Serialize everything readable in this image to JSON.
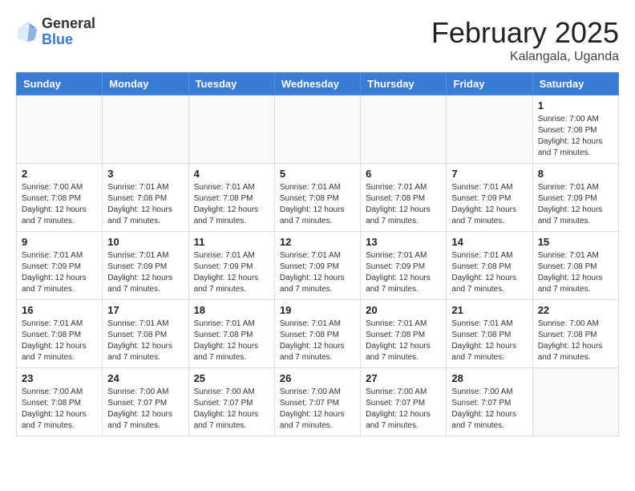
{
  "logo": {
    "general": "General",
    "blue": "Blue"
  },
  "header": {
    "month": "February 2025",
    "location": "Kalangala, Uganda"
  },
  "weekdays": [
    "Sunday",
    "Monday",
    "Tuesday",
    "Wednesday",
    "Thursday",
    "Friday",
    "Saturday"
  ],
  "weeks": [
    [
      {
        "day": "",
        "info": ""
      },
      {
        "day": "",
        "info": ""
      },
      {
        "day": "",
        "info": ""
      },
      {
        "day": "",
        "info": ""
      },
      {
        "day": "",
        "info": ""
      },
      {
        "day": "",
        "info": ""
      },
      {
        "day": "1",
        "info": "Sunrise: 7:00 AM\nSunset: 7:08 PM\nDaylight: 12 hours\nand 7 minutes."
      }
    ],
    [
      {
        "day": "2",
        "info": "Sunrise: 7:00 AM\nSunset: 7:08 PM\nDaylight: 12 hours\nand 7 minutes."
      },
      {
        "day": "3",
        "info": "Sunrise: 7:01 AM\nSunset: 7:08 PM\nDaylight: 12 hours\nand 7 minutes."
      },
      {
        "day": "4",
        "info": "Sunrise: 7:01 AM\nSunset: 7:08 PM\nDaylight: 12 hours\nand 7 minutes."
      },
      {
        "day": "5",
        "info": "Sunrise: 7:01 AM\nSunset: 7:08 PM\nDaylight: 12 hours\nand 7 minutes."
      },
      {
        "day": "6",
        "info": "Sunrise: 7:01 AM\nSunset: 7:08 PM\nDaylight: 12 hours\nand 7 minutes."
      },
      {
        "day": "7",
        "info": "Sunrise: 7:01 AM\nSunset: 7:09 PM\nDaylight: 12 hours\nand 7 minutes."
      },
      {
        "day": "8",
        "info": "Sunrise: 7:01 AM\nSunset: 7:09 PM\nDaylight: 12 hours\nand 7 minutes."
      }
    ],
    [
      {
        "day": "9",
        "info": "Sunrise: 7:01 AM\nSunset: 7:09 PM\nDaylight: 12 hours\nand 7 minutes."
      },
      {
        "day": "10",
        "info": "Sunrise: 7:01 AM\nSunset: 7:09 PM\nDaylight: 12 hours\nand 7 minutes."
      },
      {
        "day": "11",
        "info": "Sunrise: 7:01 AM\nSunset: 7:09 PM\nDaylight: 12 hours\nand 7 minutes."
      },
      {
        "day": "12",
        "info": "Sunrise: 7:01 AM\nSunset: 7:09 PM\nDaylight: 12 hours\nand 7 minutes."
      },
      {
        "day": "13",
        "info": "Sunrise: 7:01 AM\nSunset: 7:09 PM\nDaylight: 12 hours\nand 7 minutes."
      },
      {
        "day": "14",
        "info": "Sunrise: 7:01 AM\nSunset: 7:08 PM\nDaylight: 12 hours\nand 7 minutes."
      },
      {
        "day": "15",
        "info": "Sunrise: 7:01 AM\nSunset: 7:08 PM\nDaylight: 12 hours\nand 7 minutes."
      }
    ],
    [
      {
        "day": "16",
        "info": "Sunrise: 7:01 AM\nSunset: 7:08 PM\nDaylight: 12 hours\nand 7 minutes."
      },
      {
        "day": "17",
        "info": "Sunrise: 7:01 AM\nSunset: 7:08 PM\nDaylight: 12 hours\nand 7 minutes."
      },
      {
        "day": "18",
        "info": "Sunrise: 7:01 AM\nSunset: 7:08 PM\nDaylight: 12 hours\nand 7 minutes."
      },
      {
        "day": "19",
        "info": "Sunrise: 7:01 AM\nSunset: 7:08 PM\nDaylight: 12 hours\nand 7 minutes."
      },
      {
        "day": "20",
        "info": "Sunrise: 7:01 AM\nSunset: 7:08 PM\nDaylight: 12 hours\nand 7 minutes."
      },
      {
        "day": "21",
        "info": "Sunrise: 7:01 AM\nSunset: 7:08 PM\nDaylight: 12 hours\nand 7 minutes."
      },
      {
        "day": "22",
        "info": "Sunrise: 7:00 AM\nSunset: 7:08 PM\nDaylight: 12 hours\nand 7 minutes."
      }
    ],
    [
      {
        "day": "23",
        "info": "Sunrise: 7:00 AM\nSunset: 7:08 PM\nDaylight: 12 hours\nand 7 minutes."
      },
      {
        "day": "24",
        "info": "Sunrise: 7:00 AM\nSunset: 7:07 PM\nDaylight: 12 hours\nand 7 minutes."
      },
      {
        "day": "25",
        "info": "Sunrise: 7:00 AM\nSunset: 7:07 PM\nDaylight: 12 hours\nand 7 minutes."
      },
      {
        "day": "26",
        "info": "Sunrise: 7:00 AM\nSunset: 7:07 PM\nDaylight: 12 hours\nand 7 minutes."
      },
      {
        "day": "27",
        "info": "Sunrise: 7:00 AM\nSunset: 7:07 PM\nDaylight: 12 hours\nand 7 minutes."
      },
      {
        "day": "28",
        "info": "Sunrise: 7:00 AM\nSunset: 7:07 PM\nDaylight: 12 hours\nand 7 minutes."
      },
      {
        "day": "",
        "info": ""
      }
    ]
  ]
}
